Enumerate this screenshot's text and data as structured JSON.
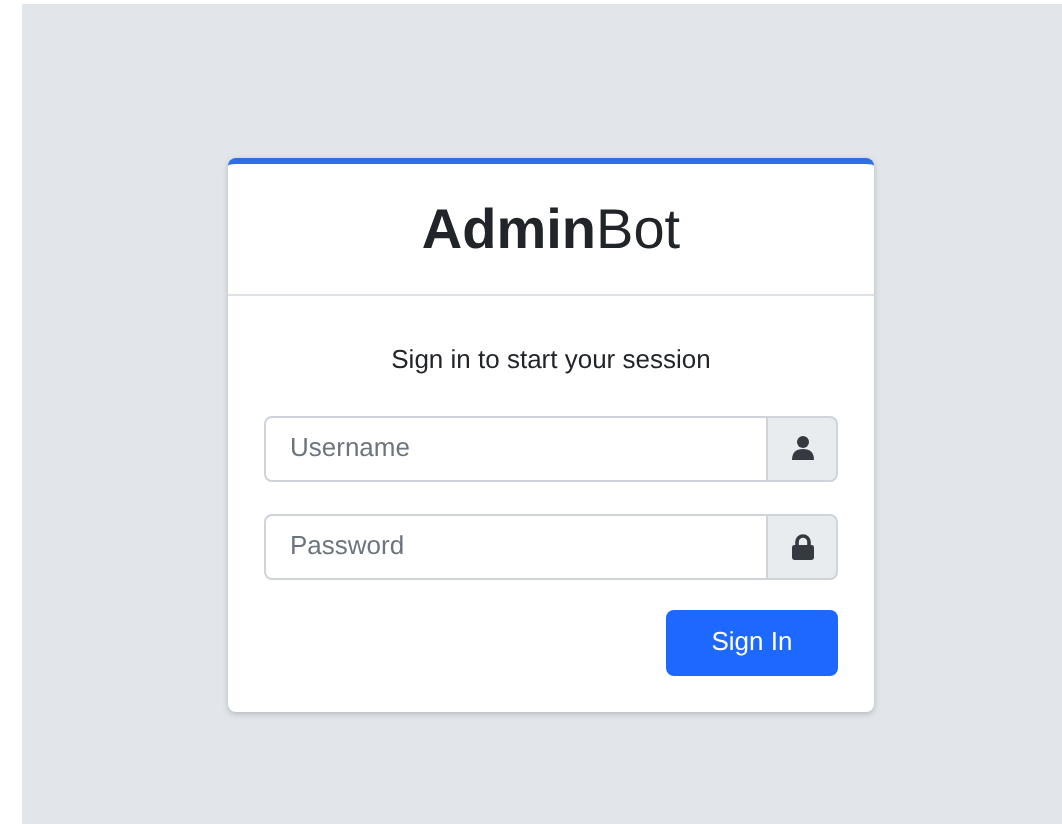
{
  "logo": "**Admin**Bot",
  "subtitle": "Sign in to start your session",
  "fields": [
    {
      "kind": "user",
      "placeholder": "Username"
    },
    {
      "kind": "lock",
      "placeholder": "Password"
    }
  ],
  "button": "Sign In"
}
